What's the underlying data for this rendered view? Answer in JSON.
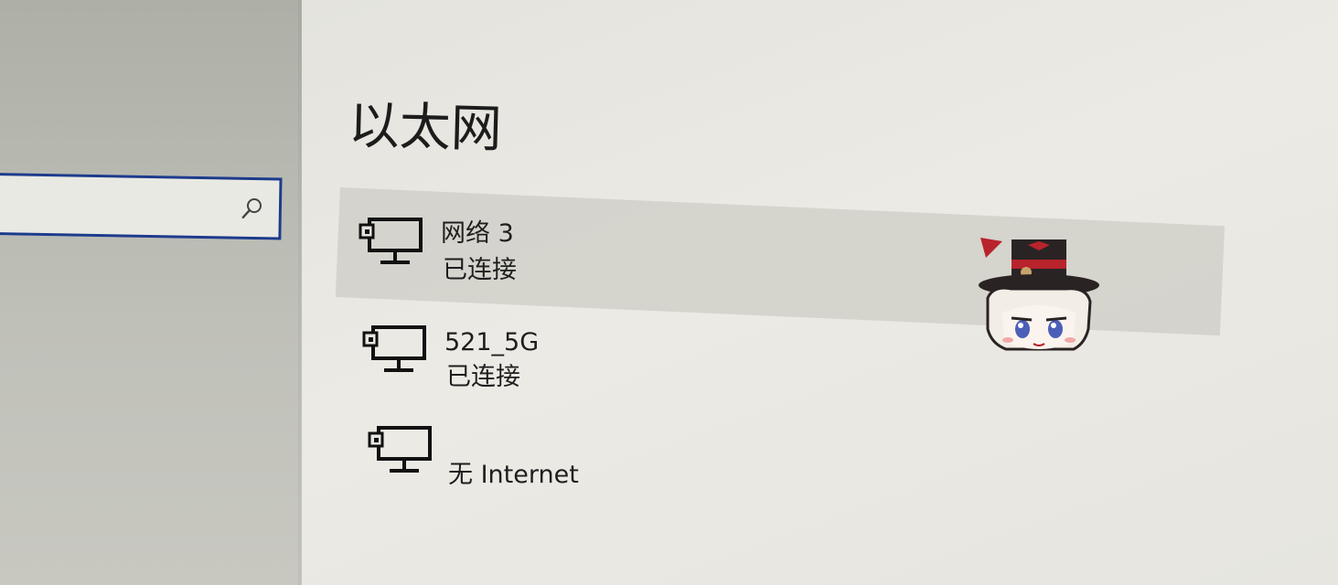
{
  "window": {
    "title": "以太网"
  },
  "search": {
    "icon": "search-icon"
  },
  "networks": [
    {
      "name": "网络 3",
      "status": "已连接",
      "icon": "ethernet-monitor-icon",
      "selected": true
    },
    {
      "name": "521_5G",
      "status": "已连接",
      "icon": "ethernet-monitor-icon",
      "selected": false
    },
    {
      "name": "",
      "status": "无 Internet",
      "icon": "ethernet-monitor-icon",
      "selected": false
    }
  ],
  "mascot": {
    "icon": "chibi-character-icon"
  },
  "colors": {
    "search_border": "#1d3b8c",
    "selection": "#cdccc5",
    "text": "#1e1e1e"
  }
}
